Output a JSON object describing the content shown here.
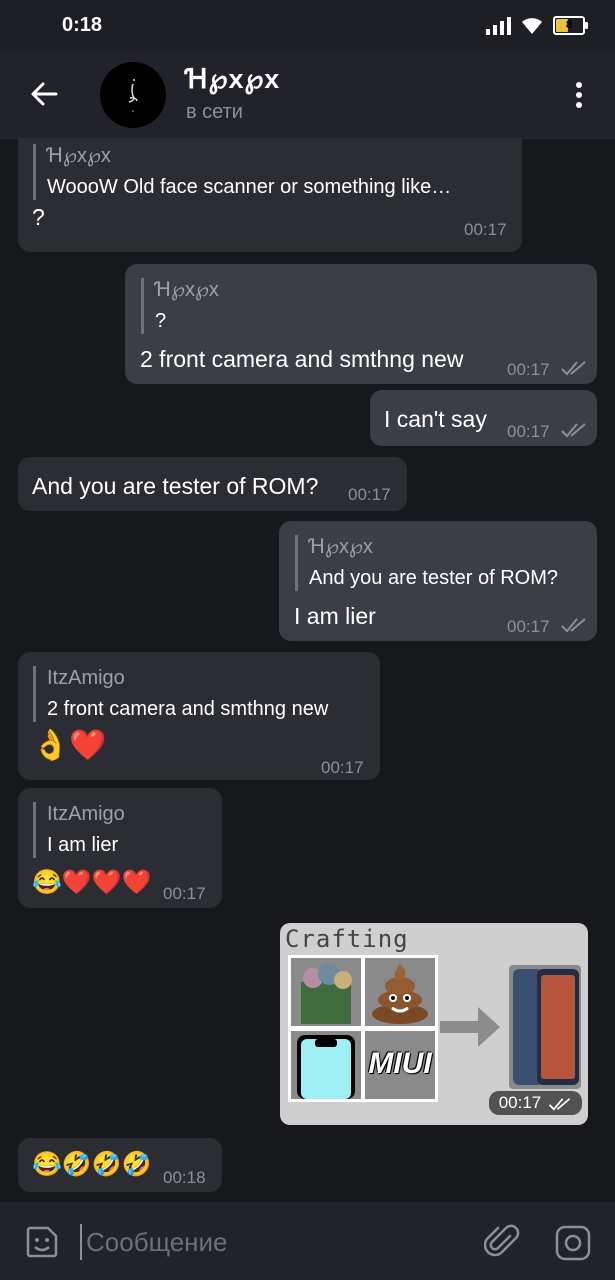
{
  "status_bar": {
    "time": "0:18",
    "battery": "8",
    "icons": [
      "signal-icon",
      "wifi-icon",
      "battery-icon"
    ]
  },
  "header": {
    "name": "Ɦ℘x℘x",
    "status": "в сети",
    "icons": [
      "back-arrow-icon",
      "more-vertical-icon"
    ]
  },
  "messages": [
    {
      "reply_name": "Ɦ℘x℘x",
      "reply_text": "WoooW  Old face scanner or something like…",
      "text": "?",
      "time": "00:17"
    },
    {
      "reply_name": "Ɦ℘x℘x",
      "reply_text": "?",
      "text": "2 front camera and smthng new",
      "time": "00:17"
    },
    {
      "text": "I can't say",
      "time": "00:17"
    },
    {
      "text": "And you are tester of ROM?",
      "time": "00:17"
    },
    {
      "reply_name": "Ɦ℘x℘x",
      "reply_text": "And you are tester of ROM?",
      "text": "I am lier",
      "time": "00:17"
    },
    {
      "reply_name": "ItzAmigo",
      "reply_text": "2 front camera and smthng new",
      "text": "👌❤️",
      "time": "00:17"
    },
    {
      "reply_name": "ItzAmigo",
      "reply_text": "I am lier",
      "text": "😂❤️❤️❤️",
      "time": "00:17"
    },
    {
      "image_title": "Crafting",
      "image_label": "MIUI",
      "time": "00:17"
    },
    {
      "text": "😂🤣🤣🤣",
      "time": "00:18"
    }
  ],
  "composer": {
    "placeholder": "Сообщение",
    "icons": [
      "sticker-icon",
      "attach-icon",
      "camera-icon"
    ]
  },
  "colors": {
    "background": "#17181c",
    "bubble_in": "#2b2d33",
    "bubble_out": "#3b3e45",
    "header": "#22232a"
  }
}
